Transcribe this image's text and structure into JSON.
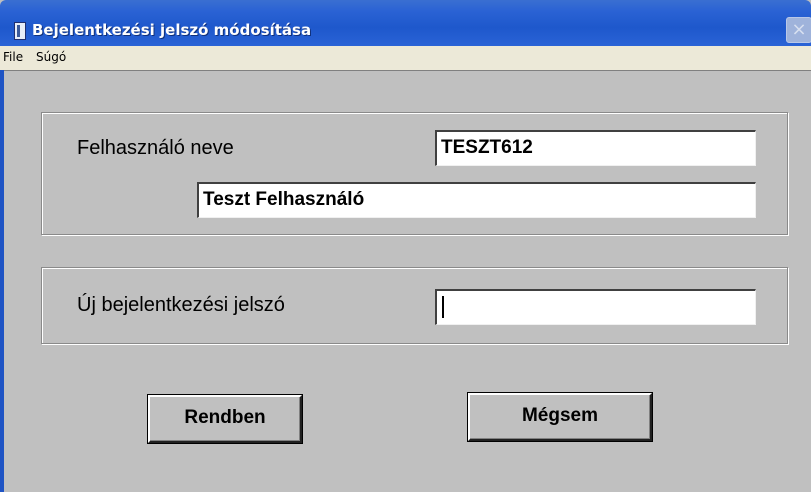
{
  "window": {
    "title": "Bejelentkezési jelszó módosítása",
    "close_symbol": "×"
  },
  "menu": {
    "items": [
      {
        "label": "File"
      },
      {
        "label": "Súgó"
      }
    ]
  },
  "user_group": {
    "username_label": "Felhasználó neve",
    "username_value": "TESZT612",
    "fullname_value": "Teszt Felhasználó"
  },
  "password_group": {
    "new_password_label": "Új bejelentkezési jelszó",
    "new_password_value": ""
  },
  "buttons": {
    "ok_label": "Rendben",
    "cancel_label": "Mégsem"
  },
  "colors": {
    "titlebar": "#245ed8",
    "client_background": "#c0c0c0",
    "menubar": "#ece9d8"
  }
}
